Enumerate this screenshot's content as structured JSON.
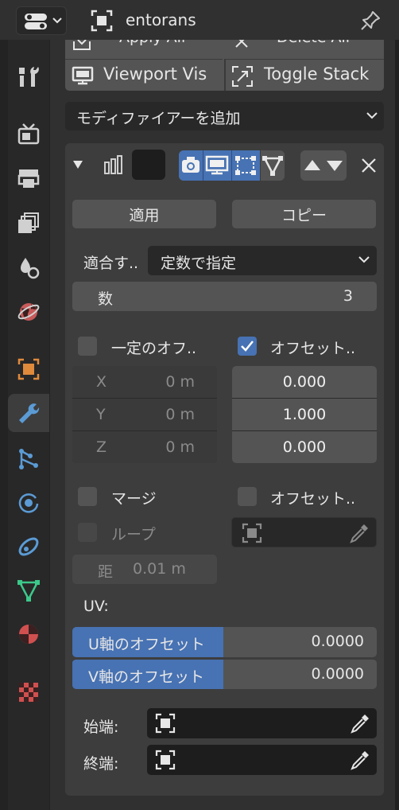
{
  "header": {
    "object_name": "entorans"
  },
  "top_ops": {
    "apply_all": "Apply All",
    "delete_all": "Delete All",
    "viewport_vis": "Viewport Vis",
    "toggle_stack": "Toggle Stack"
  },
  "add_modifier": "モディファイアーを追加",
  "modifier": {
    "name": "",
    "apply": "適用",
    "copy": "コピー",
    "fit_label": "適合す..",
    "fit_value": "定数で指定",
    "count_label": "数",
    "count_value": "3",
    "constant_offset_label": "一定のオフ..",
    "constant_offset_checked": false,
    "relative_offset_label": "オフセット..",
    "relative_offset_checked": true,
    "constant": {
      "x_label": "X",
      "x_value": "0 m",
      "y_label": "Y",
      "y_value": "0 m",
      "z_label": "Z",
      "z_value": "0 m"
    },
    "relative": {
      "x_value": "0.000",
      "y_value": "1.000",
      "z_value": "0.000"
    },
    "merge_label": "マージ",
    "merge_checked": false,
    "object_offset_label": "オフセット..",
    "object_offset_checked": false,
    "loop_label": "ループ",
    "distance_label": "距",
    "distance_value": "0.01 m",
    "uv_label": "UV:",
    "u_offset_label": "U軸のオフセット",
    "u_offset_value": "0.0000",
    "v_offset_label": "V軸のオフセット",
    "v_offset_value": "0.0000",
    "start_cap_label": "始端:",
    "end_cap_label": "終端:"
  },
  "colors": {
    "accent": "#4772b3",
    "panel_bg": "#3d3d3d",
    "field_bg": "#545454"
  }
}
